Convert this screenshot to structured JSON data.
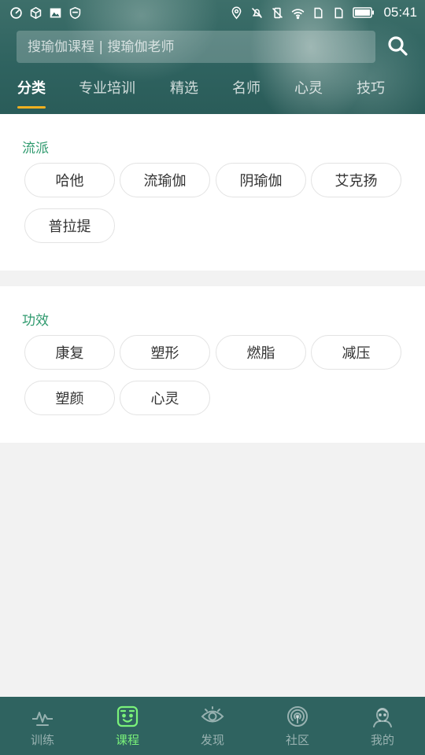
{
  "status_bar": {
    "time": "05:41",
    "left_icons": [
      "sync-icon",
      "shield-cube-icon",
      "image-icon",
      "shield-check-icon"
    ],
    "right_icons": [
      "location-icon",
      "mute-icon",
      "vibrate-off-icon",
      "wifi-icon",
      "sim1-icon",
      "sim2-icon",
      "battery-icon"
    ]
  },
  "search": {
    "placeholder": "搜瑜伽课程 | 搜瑜伽老师",
    "icon": "search-icon"
  },
  "tabs": [
    {
      "label": "分类",
      "active": true
    },
    {
      "label": "专业培训",
      "active": false
    },
    {
      "label": "精选",
      "active": false
    },
    {
      "label": "名师",
      "active": false
    },
    {
      "label": "心灵",
      "active": false
    },
    {
      "label": "技巧",
      "active": false
    }
  ],
  "sections": [
    {
      "title": "流派",
      "chips": [
        "哈他",
        "流瑜伽",
        "阴瑜伽",
        "艾克扬",
        "普拉提"
      ]
    },
    {
      "title": "功效",
      "chips": [
        "康复",
        "塑形",
        "燃脂",
        "减压",
        "塑颜",
        "心灵"
      ]
    }
  ],
  "bottom_nav": [
    {
      "label": "训练",
      "icon": "pulse-icon",
      "active": false
    },
    {
      "label": "课程",
      "icon": "course-face-icon",
      "active": true
    },
    {
      "label": "发现",
      "icon": "eye-icon",
      "active": false
    },
    {
      "label": "社区",
      "icon": "community-signal-icon",
      "active": false
    },
    {
      "label": "我的",
      "icon": "profile-icon",
      "active": false
    }
  ],
  "colors": {
    "header_bg": "#2f6360",
    "accent_green": "#2f9a6e",
    "tab_underline": "#f0b020",
    "nav_active": "#7af27a"
  }
}
